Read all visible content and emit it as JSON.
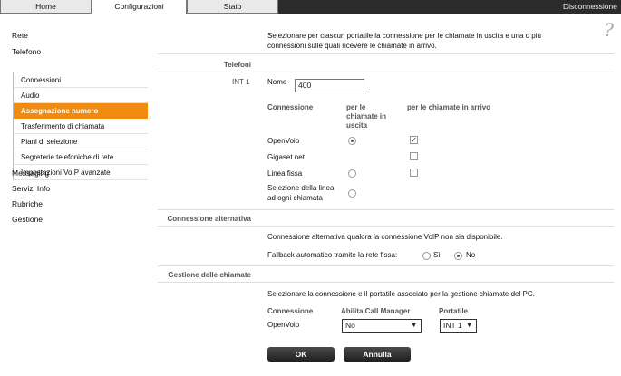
{
  "tabs": [
    "Home",
    "Configurazioni",
    "Stato"
  ],
  "logout_label": "Disconnessione",
  "help_icon": "?",
  "sidebar": {
    "items": [
      "Rete",
      "Telefono",
      "Messaging",
      "Servizi Info",
      "Rubriche",
      "Gestione"
    ],
    "telefono_sub": [
      "Connessioni",
      "Audio",
      "Assegnazione numero",
      "Trasferimento di chiamata",
      "Piani di selezione",
      "Segreterie telefoniche di rete",
      "Impostazioni VoIP avanzate"
    ]
  },
  "intro_text": [
    "Selezionare per ciascun portatile la connessione per le chiamate in uscita e una o più",
    "connessioni sulle quali ricevere le chiamate in arrivo."
  ],
  "telefoni_label": "Telefoni",
  "int_label": "INT 1",
  "nome_label": "Nome",
  "nome_value": "400",
  "conn_headers": {
    "connessione": "Connessione",
    "uscita": [
      "per le",
      "chiamate in",
      "uscita"
    ],
    "arrivo": "per le chiamate in arrivo"
  },
  "connections": [
    {
      "name": [
        "OpenVoip"
      ],
      "out": true,
      "in": true,
      "has_radio": true
    },
    {
      "name": [
        "Gigaset.net"
      ],
      "out": false,
      "in": false,
      "has_radio": false
    },
    {
      "name": [
        "Linea fissa"
      ],
      "out": false,
      "in": false,
      "has_radio": true
    },
    {
      "name": [
        "Selezione della linea",
        "ad ogni chiamata"
      ],
      "out": false,
      "in": false,
      "has_radio": true,
      "has_check": false
    }
  ],
  "alt_section": {
    "label": "Connessione alternativa",
    "text": "Connessione alternativa qualora la connessione VoIP non sia disponibile.",
    "fallback_label": "Fallback automatico tramite la rete fissa:",
    "option_si": "Sì",
    "option_no": "No",
    "selected": "No"
  },
  "call_mgmt": {
    "label": "Gestione delle chiamate",
    "text": "Selezionare la connessione e il portatile associato per la gestione chiamate del PC.",
    "headers": [
      "Connessione",
      "Abilita Call Manager",
      "Portatile"
    ],
    "row_connection": "OpenVoip",
    "call_manager_value": "No",
    "portatile_value": "INT 1"
  },
  "buttons": {
    "ok": "OK",
    "cancel": "Annulla"
  }
}
